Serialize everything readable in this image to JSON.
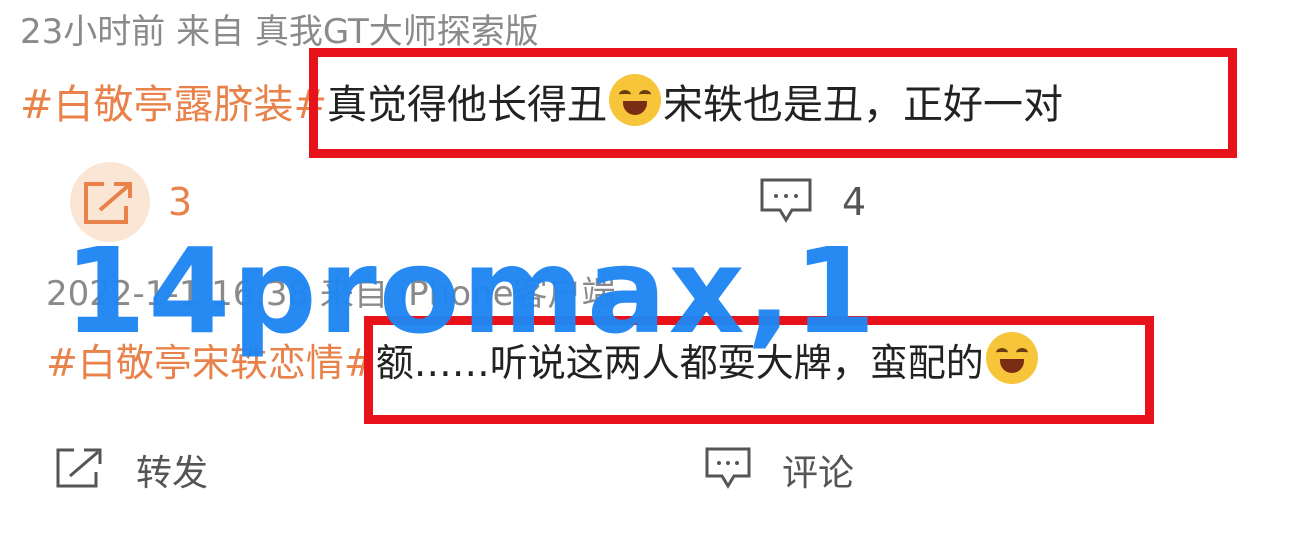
{
  "post1": {
    "meta": "23小时前  来自 真我GT大师探索版",
    "tag": "#白敬亭露脐装#",
    "text_a": "真觉得他长得丑",
    "text_b": "宋轶也是丑，正好一对",
    "share_count": "3",
    "comment_count": "4"
  },
  "post2": {
    "meta": "2022-1-1  16:38  来自 iPhone客户端",
    "tag": "#白敬亭宋轶恋情#",
    "text": "额……听说这两人都耍大牌，蛮配的",
    "share_label": "转发",
    "comment_label": "评论"
  },
  "watermark": "14promax,1",
  "colors": {
    "highlight_box": "#e8121b",
    "tag": "#e8824a",
    "watermark": "#1f86f3"
  },
  "icons": [
    "share-icon",
    "comment-icon",
    "cry-laugh-emoji-icon",
    "laugh-emoji-icon"
  ]
}
